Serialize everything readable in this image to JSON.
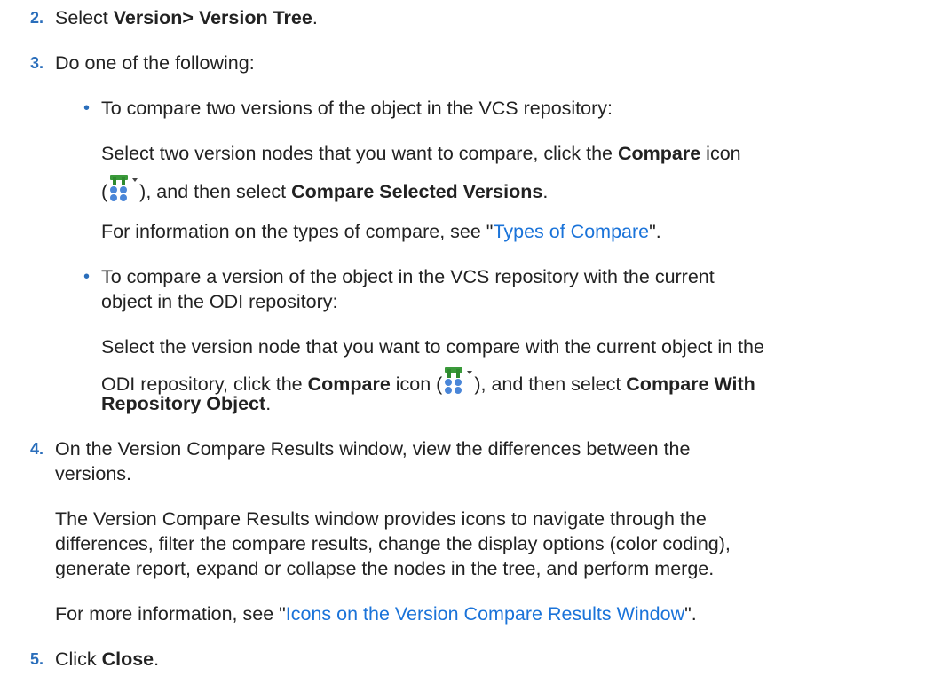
{
  "steps": {
    "s2": {
      "num": "2.",
      "pre": "Select ",
      "bold": "Version> Version Tree",
      "post": "."
    },
    "s3": {
      "num": "3.",
      "text": "Do one of the following:",
      "b1": {
        "intro": "To compare two versions of the object in the VCS repository:",
        "l1_pre": "Select two version nodes that you want to compare, click the ",
        "l1_bold": "Compare",
        "l1_post": " icon",
        "l2_open": "(",
        "l2_mid": "), and then select ",
        "l2_bold": "Compare Selected Versions",
        "l2_end": ".",
        "info_pre": "For information on the types of compare, see \"",
        "info_link": "Types of Compare",
        "info_post": "\"."
      },
      "b2": {
        "intro1": "To compare a version of the object in the VCS repository with the current",
        "intro2": "object in the ODI repository:",
        "l1": "Select the version node that you want to compare with the current object in the",
        "l2_pre": "ODI repository, click the ",
        "l2_bold": "Compare",
        "l2_mid": " icon (",
        "l2_after": "), and then select ",
        "l2_bold2": "Compare With",
        "l3_bold": "Repository Object",
        "l3_end": "."
      }
    },
    "s4": {
      "num": "4.",
      "line1": "On the Version Compare Results window, view the differences between the",
      "line2": "versions.",
      "p1": "The Version Compare Results window provides icons to navigate through the",
      "p2": "differences, filter the compare results, change the display options (color coding),",
      "p3": "generate report, expand or collapse the nodes in the tree, and perform merge.",
      "more_pre": "For more information, see \"",
      "more_link": "Icons on the Version Compare Results Window",
      "more_post": "\"."
    },
    "s5": {
      "num": "5.",
      "pre": "Click ",
      "bold": "Close",
      "post": "."
    }
  },
  "icons": {
    "compare": "compare-icon"
  }
}
